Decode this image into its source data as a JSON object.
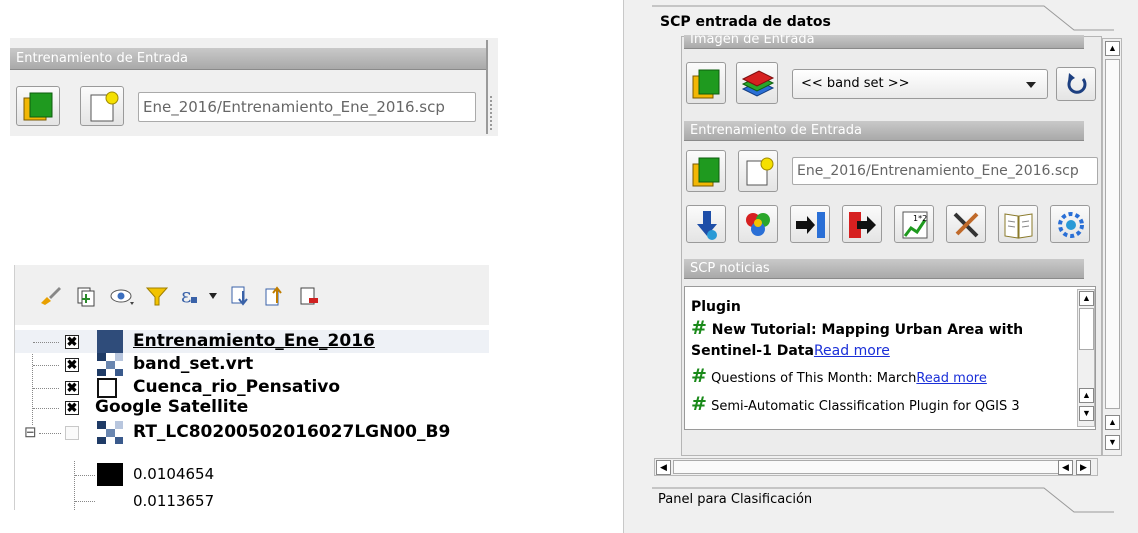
{
  "top_left": {
    "header": "Entrenamiento de Entrada",
    "path": "Ene_2016/Entrenamiento_Ene_2016.scp"
  },
  "layers": {
    "rows": [
      {
        "label": "Entrenamiento_Ene_2016",
        "checked": "✖"
      },
      {
        "label": "band_set.vrt",
        "checked": "✖"
      },
      {
        "label": "Cuenca_rio_Pensativo",
        "checked": "✖"
      },
      {
        "label": "Google Satellite",
        "checked": "✖"
      },
      {
        "label": "RT_LC80200502016027LGN00_B9",
        "checked": ""
      }
    ],
    "expand_symbol": "⊟",
    "values": [
      "0.0104654",
      "0.0113657"
    ]
  },
  "dock": {
    "title": "SCP entrada de datos",
    "input_image_header": "Imagen de Entrada",
    "band_set_select": "<< band set >>",
    "training_header": "Entrenamiento de Entrada",
    "training_path": "Ene_2016/Entrenamiento_Ene_2016.scp",
    "news_header": "SCP noticias",
    "news": {
      "plugin_label": "Plugin",
      "items": [
        {
          "text": "New Tutorial: Mapping Urban Area with",
          "text2": "Sentinel-1 Data",
          "link": "Read more",
          "bold": true
        },
        {
          "text": "Questions of This Month: March",
          "link": "Read more",
          "bold": false
        },
        {
          "text": "Semi-Automatic Classification Plugin for QGIS 3",
          "link": "",
          "bold": false
        }
      ]
    },
    "footer": "Panel para Clasificación"
  },
  "colors": {
    "header_gray": "#b0b0b0",
    "link_blue": "#1a2fd8",
    "hash_green": "#1a8a1a"
  }
}
